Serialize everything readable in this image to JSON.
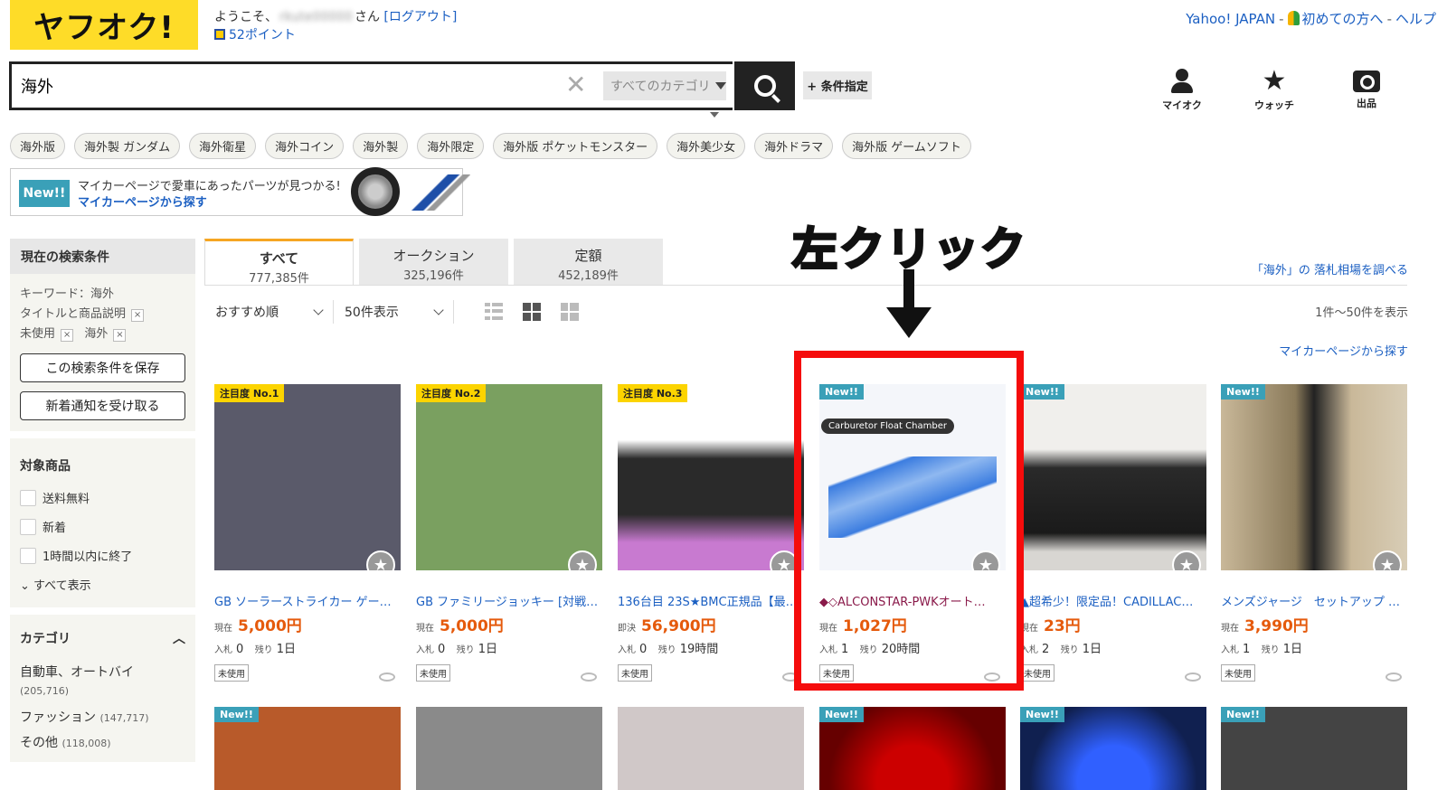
{
  "header": {
    "logo": "ヤフオク!",
    "welcome_prefix": "ようこそ、",
    "welcome_name": "rkute00000",
    "welcome_suffix": "さん",
    "logout": "[ログアウト]",
    "points": "52ポイント",
    "links": [
      "Yahoo! JAPAN",
      "初めての方へ",
      "ヘルプ"
    ]
  },
  "search": {
    "value": "海外",
    "category": "すべてのカテゴリ",
    "condition_button": "+ 条件指定"
  },
  "top_icons": [
    "マイオク",
    "ウォッチ",
    "出品"
  ],
  "tags": [
    "海外版",
    "海外製 ガンダム",
    "海外衛星",
    "海外コイン",
    "海外製",
    "海外限定",
    "海外版 ポケットモンスター",
    "海外美少女",
    "海外ドラマ",
    "海外版 ゲームソフト"
  ],
  "banner": {
    "badge": "New!!",
    "text": "マイカーページで愛車にあったパーツが見つかる!",
    "link": "マイカーページから探す"
  },
  "sidebar": {
    "current_title": "現在の検索条件",
    "keyword": "キーワード：海外",
    "scope": "タイトルと商品説明",
    "cond1": "未使用",
    "cond2": "海外",
    "save_button": "この検索条件を保存",
    "notify_button": "新着通知を受け取る",
    "target_title": "対象商品",
    "checks": [
      "送料無料",
      "新着",
      "1時間以内に終了"
    ],
    "show_all": "すべて表示",
    "category_title": "カテゴリ",
    "categories": [
      {
        "name": "自動車、オートバイ",
        "count": "(205,716)"
      },
      {
        "name": "ファッション",
        "count": "(147,717)"
      },
      {
        "name": "その他",
        "count": "(118,008)"
      }
    ]
  },
  "tabs": [
    {
      "label": "すべて",
      "count": "777,385件"
    },
    {
      "label": "オークション",
      "count": "325,196件"
    },
    {
      "label": "定額",
      "count": "452,189件"
    }
  ],
  "market_link": "「海外」の 落札相場を調べる",
  "sort": {
    "order": "おすすめ順",
    "per_page": "50件表示"
  },
  "range_text": "1件～50件を表示",
  "mycar_link": "マイカーページから探す",
  "products": [
    {
      "badge": "注目度 No.1",
      "title": "GB ソーラーストライカー ゲー…",
      "price_label": "現在",
      "price": "5,000円",
      "bid_label": "入札",
      "bids": "0",
      "remain_label": "残り",
      "remain": "1日",
      "condition": "未使用",
      "color": "#5a5a6a"
    },
    {
      "badge": "注目度 No.2",
      "title": "GB ファミリージョッキー [対戦…",
      "price_label": "現在",
      "price": "5,000円",
      "bid_label": "入札",
      "bids": "0",
      "remain_label": "残り",
      "remain": "1日",
      "condition": "未使用",
      "color": "#7aa060"
    },
    {
      "badge": "注目度 No.3",
      "title": "136台目 23S★BMC正規品【最…",
      "price_label": "即決",
      "price": "56,900円",
      "bid_label": "入札",
      "bids": "0",
      "remain_label": "残り",
      "remain": "19時間",
      "condition": "未使用",
      "color": "#c87ad0"
    },
    {
      "badge": "New!!",
      "title": "◆◇ALCONSTAR-PWKオート…",
      "price_label": "現在",
      "price": "1,027円",
      "bid_label": "入札",
      "bids": "1",
      "remain_label": "残り",
      "remain": "20時間",
      "condition": "未使用",
      "color": "#f4f6fa",
      "overlay": "Carburetor Float Chamber"
    },
    {
      "badge": "New!!",
      "title": "▲超希少！限定品！CADILLAC…",
      "price_label": "現在",
      "price": "23円",
      "bid_label": "入札",
      "bids": "2",
      "remain_label": "残り",
      "remain": "1日",
      "condition": "未使用",
      "color": "#3a3a3a"
    },
    {
      "badge": "New!!",
      "title": "メンズジャージ　セットアップ …",
      "price_label": "現在",
      "price": "3,990円",
      "bid_label": "入札",
      "bids": "1",
      "remain_label": "残り",
      "remain": "1日",
      "condition": "未使用",
      "color": "#8a7a5a"
    }
  ],
  "row2_badges": [
    "New!!",
    "",
    "",
    "New!!",
    "New!!",
    "New!!"
  ],
  "annotation": "左クリック"
}
